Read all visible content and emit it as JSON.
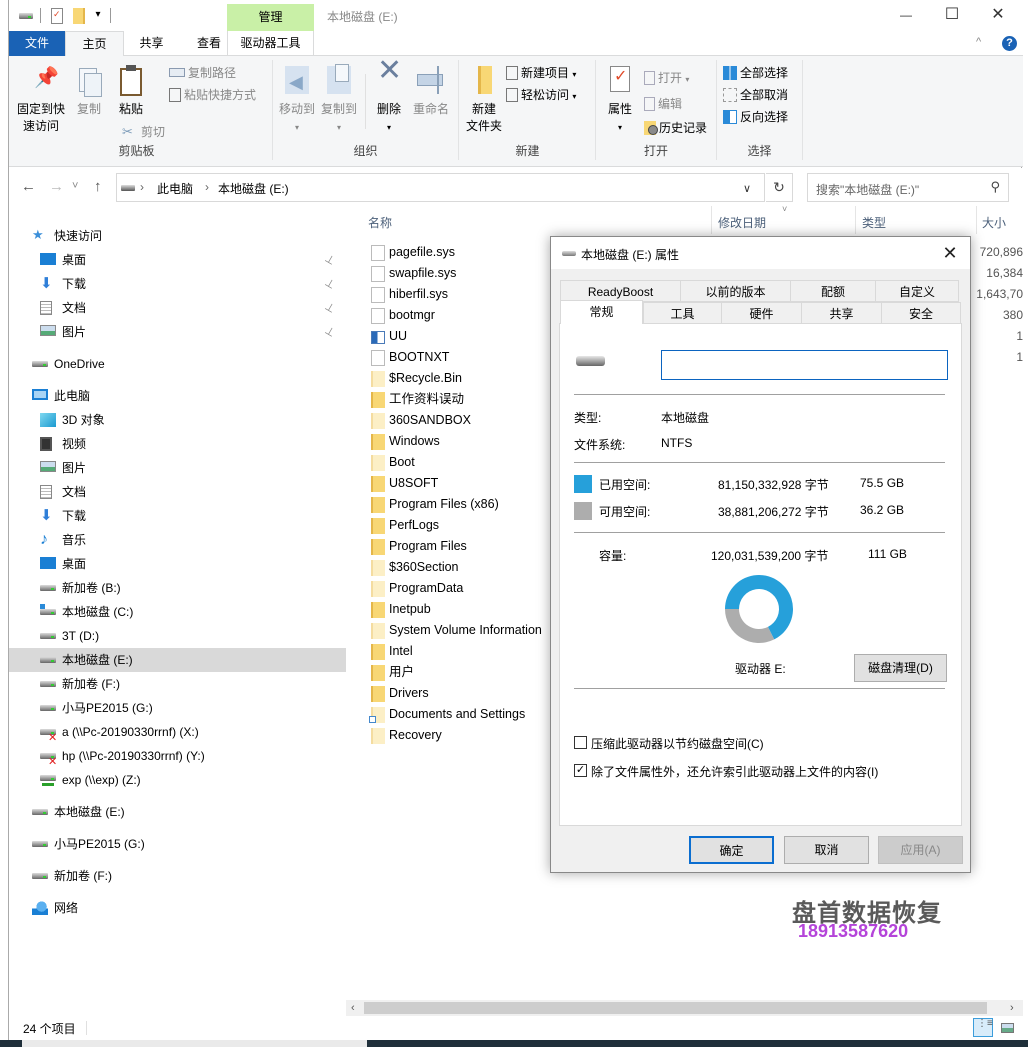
{
  "titlebar": {
    "manage_tab": "管理",
    "window_title": "本地磁盘 (E:)",
    "minimize_glyph": "—",
    "maximize_glyph": "☐",
    "close_glyph": "✕"
  },
  "ribbon_tabs": {
    "file": "文件",
    "home": "主页",
    "share": "共享",
    "view": "查看",
    "drive_tools": "驱动器工具",
    "help_glyph": "?",
    "collapse_glyph": "^"
  },
  "ribbon": {
    "clipboard": {
      "label": "剪贴板",
      "pin_line1": "固定到快",
      "pin_line2": "速访问",
      "copy": "复制",
      "paste": "粘贴",
      "copy_path": "复制路径",
      "paste_shortcut": "粘贴快捷方式",
      "cut": "剪切"
    },
    "organize": {
      "label": "组织",
      "move_to": "移动到",
      "copy_to": "复制到",
      "delete": "删除",
      "rename": "重命名"
    },
    "new": {
      "label": "新建",
      "new_folder_line1": "新建",
      "new_folder_line2": "文件夹",
      "new_item": "新建项目",
      "easy_access": "轻松访问"
    },
    "open": {
      "label": "打开",
      "properties": "属性",
      "open": "打开",
      "edit": "编辑",
      "history": "历史记录"
    },
    "select": {
      "label": "选择",
      "select_all": "全部选择",
      "select_none": "全部取消",
      "invert": "反向选择"
    }
  },
  "navbar": {
    "back_glyph": "←",
    "forward_glyph": "→",
    "recent_glyph": "˅",
    "up_glyph": "↑",
    "breadcrumb": [
      "此电脑",
      "本地磁盘 (E:)"
    ],
    "refresh_glyph": "↻",
    "search_placeholder": "搜索\"本地磁盘 (E:)\"",
    "search_glyph": "⚲"
  },
  "navpane": {
    "items": [
      {
        "label": "快速访问",
        "icon": "star-icon",
        "level": 0
      },
      {
        "label": "桌面",
        "icon": "desktop-icon",
        "level": 1,
        "pinned": true
      },
      {
        "label": "下载",
        "icon": "download-icon",
        "level": 1,
        "pinned": true
      },
      {
        "label": "文档",
        "icon": "document-icon",
        "level": 1,
        "pinned": true
      },
      {
        "label": "图片",
        "icon": "picture-icon",
        "level": 1,
        "pinned": true
      },
      {
        "label": "OneDrive",
        "icon": "onedrive-icon",
        "level": 0
      },
      {
        "label": "此电脑",
        "icon": "computer-icon",
        "level": 0
      },
      {
        "label": "3D 对象",
        "icon": "3d-objects-icon",
        "level": 1
      },
      {
        "label": "视频",
        "icon": "video-icon",
        "level": 1
      },
      {
        "label": "图片",
        "icon": "picture-icon",
        "level": 1
      },
      {
        "label": "文档",
        "icon": "document-icon",
        "level": 1
      },
      {
        "label": "下载",
        "icon": "download-icon",
        "level": 1
      },
      {
        "label": "音乐",
        "icon": "music-icon",
        "level": 1
      },
      {
        "label": "桌面",
        "icon": "desktop-icon",
        "level": 1
      },
      {
        "label": "新加卷 (B:)",
        "icon": "drive-icon",
        "level": 1
      },
      {
        "label": "本地磁盘 (C:)",
        "icon": "system-drive-icon",
        "level": 1
      },
      {
        "label": "3T (D:)",
        "icon": "drive-icon",
        "level": 1
      },
      {
        "label": "本地磁盘 (E:)",
        "icon": "drive-icon",
        "level": 1,
        "selected": true
      },
      {
        "label": "新加卷 (F:)",
        "icon": "drive-icon",
        "level": 1
      },
      {
        "label": "小马PE2015 (G:)",
        "icon": "drive-icon",
        "level": 1
      },
      {
        "label": "a (\\\\Pc-20190330rrnf) (X:)",
        "icon": "disconnected-network-drive-icon",
        "level": 1
      },
      {
        "label": "hp (\\\\Pc-20190330rrnf) (Y:)",
        "icon": "disconnected-network-drive-icon",
        "level": 1
      },
      {
        "label": "exp (\\\\exp) (Z:)",
        "icon": "network-drive-icon",
        "level": 1
      },
      {
        "label": "本地磁盘 (E:)",
        "icon": "drive-icon",
        "level": 0
      },
      {
        "label": "小马PE2015 (G:)",
        "icon": "drive-icon",
        "level": 0
      },
      {
        "label": "新加卷 (F:)",
        "icon": "drive-icon",
        "level": 0
      },
      {
        "label": "网络",
        "icon": "network-icon",
        "level": 0
      }
    ],
    "pin_glyph": "📌"
  },
  "filelist": {
    "columns": {
      "name": "名称",
      "modified": "修改日期",
      "type": "类型",
      "size": "大小"
    },
    "sort_glyph": "˅",
    "files": [
      {
        "name": "pagefile.sys",
        "kind": "sysfile",
        "size": "720,896"
      },
      {
        "name": "swapfile.sys",
        "kind": "sysfile",
        "size": "16,384"
      },
      {
        "name": "hiberfil.sys",
        "kind": "sysfile",
        "size": "1,643,70"
      },
      {
        "name": "bootmgr",
        "kind": "sysfile",
        "size": "380"
      },
      {
        "name": "UU",
        "kind": "shortcut",
        "size": "1"
      },
      {
        "name": "BOOTNXT",
        "kind": "sysfile",
        "size": "1"
      },
      {
        "name": "$Recycle.Bin",
        "kind": "hidden-folder",
        "size": ""
      },
      {
        "name": "工作资料误动",
        "kind": "folder",
        "size": ""
      },
      {
        "name": "360SANDBOX",
        "kind": "hidden-folder",
        "size": ""
      },
      {
        "name": "Windows",
        "kind": "folder",
        "size": ""
      },
      {
        "name": "Boot",
        "kind": "hidden-folder",
        "size": ""
      },
      {
        "name": "U8SOFT",
        "kind": "folder",
        "size": ""
      },
      {
        "name": "Program Files (x86)",
        "kind": "folder",
        "size": ""
      },
      {
        "name": "PerfLogs",
        "kind": "folder",
        "size": ""
      },
      {
        "name": "Program Files",
        "kind": "folder",
        "size": ""
      },
      {
        "name": "$360Section",
        "kind": "hidden-folder",
        "size": ""
      },
      {
        "name": "ProgramData",
        "kind": "hidden-folder",
        "size": ""
      },
      {
        "name": "Inetpub",
        "kind": "folder",
        "size": ""
      },
      {
        "name": "System Volume Information",
        "kind": "hidden-folder",
        "size": ""
      },
      {
        "name": "Intel",
        "kind": "folder",
        "size": ""
      },
      {
        "name": "用户",
        "kind": "folder",
        "size": ""
      },
      {
        "name": "Drivers",
        "kind": "folder",
        "size": ""
      },
      {
        "name": "Documents and Settings",
        "kind": "hidden-folder-link",
        "size": ""
      },
      {
        "name": "Recovery",
        "kind": "hidden-folder",
        "size": ""
      }
    ]
  },
  "statusbar": {
    "item_count": "24 个项目"
  },
  "watermark": {
    "brand": "盘首数据恢复",
    "phone": "18913587620"
  },
  "dialog": {
    "title": "本地磁盘 (E:) 属性",
    "close_glyph": "✕",
    "tabs_row1": [
      "ReadyBoost",
      "以前的版本",
      "配额",
      "自定义"
    ],
    "tabs_row2": [
      "常规",
      "工具",
      "硬件",
      "共享",
      "安全"
    ],
    "active_tab": "常规",
    "volume_label_value": "",
    "type_label": "类型:",
    "type_value": "本地磁盘",
    "fs_label": "文件系统:",
    "fs_value": "NTFS",
    "used_label": "已用空间:",
    "used_bytes": "81,150,332,928 字节",
    "used_gb": "75.5 GB",
    "free_label": "可用空间:",
    "free_bytes": "38,881,206,272 字节",
    "free_gb": "36.2 GB",
    "capacity_label": "容量:",
    "capacity_bytes": "120,031,539,200 字节",
    "capacity_gb": "111 GB",
    "used_fraction": 0.676,
    "used_color": "#26a0da",
    "free_color": "#adadad",
    "drive_label": "驱动器 E:",
    "cleanup_button": "磁盘清理(D)",
    "compress_checkbox": "压缩此驱动器以节约磁盘空间(C)",
    "compress_checked": false,
    "index_checkbox": "除了文件属性外，还允许索引此驱动器上文件的内容(I)",
    "index_checked": true,
    "ok_button": "确定",
    "cancel_button": "取消",
    "apply_button": "应用(A)"
  }
}
